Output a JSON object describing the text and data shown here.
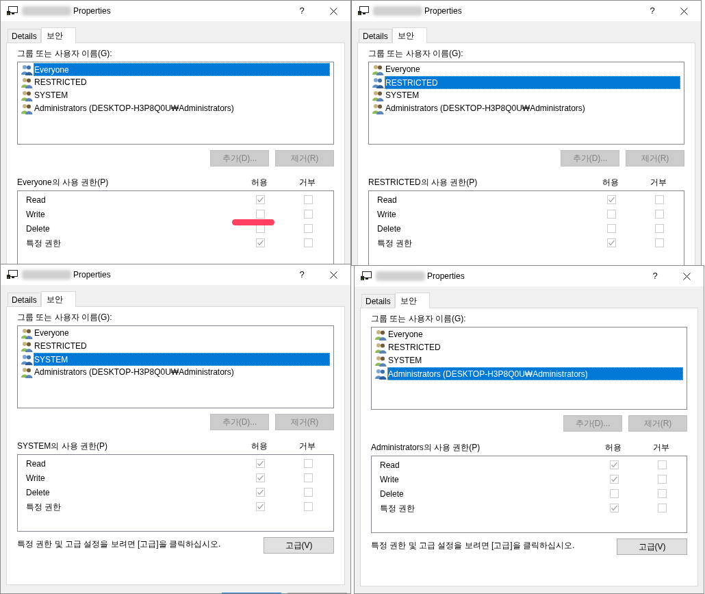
{
  "windows": [
    {
      "title": "Properties",
      "name_hidden": true,
      "help": "?",
      "tabs": [
        {
          "label": "Details",
          "selected": false
        },
        {
          "label": "보안",
          "selected": true
        }
      ],
      "groups_label": "그룹 또는 사용자 이름(G):",
      "groups": [
        {
          "name": "Everyone",
          "selected": true
        },
        {
          "name": "RESTRICTED",
          "selected": false
        },
        {
          "name": "SYSTEM",
          "selected": false
        },
        {
          "name": "Administrators (DESKTOP-H3P8Q0U₩Administrators)",
          "selected": false
        }
      ],
      "buttons": [
        {
          "label": "추가(D)...",
          "disabled": true
        },
        {
          "label": "제거(R)",
          "disabled": true
        }
      ],
      "permissions_label": "Everyone의 사용 권한(P)",
      "columns": [
        "허용",
        "거부"
      ],
      "permissions": [
        {
          "name": "Read",
          "allow": true,
          "deny": false
        },
        {
          "name": "Write",
          "allow": false,
          "deny": false
        },
        {
          "name": "Delete",
          "allow": false,
          "deny": false
        },
        {
          "name": "특정 권한",
          "allow": true,
          "deny": false
        }
      ],
      "highlight_stroke": true
    },
    {
      "title": "Properties",
      "name_hidden": true,
      "help": "?",
      "tabs": [
        {
          "label": "Details",
          "selected": false
        },
        {
          "label": "보안",
          "selected": true
        }
      ],
      "groups_label": "그룹 또는 사용자 이름(G):",
      "groups": [
        {
          "name": "Everyone",
          "selected": false
        },
        {
          "name": "RESTRICTED",
          "selected": true
        },
        {
          "name": "SYSTEM",
          "selected": false
        },
        {
          "name": "Administrators (DESKTOP-H3P8Q0U₩Administrators)",
          "selected": false
        }
      ],
      "buttons": [
        {
          "label": "추가(D)...",
          "disabled": true
        },
        {
          "label": "제거(R)",
          "disabled": true
        }
      ],
      "permissions_label": "RESTRICTED의 사용 권한(P)",
      "columns": [
        "허용",
        "거부"
      ],
      "permissions": [
        {
          "name": "Read",
          "allow": true,
          "deny": false
        },
        {
          "name": "Write",
          "allow": false,
          "deny": false
        },
        {
          "name": "Delete",
          "allow": false,
          "deny": false
        },
        {
          "name": "특정 권한",
          "allow": true,
          "deny": false
        }
      ]
    },
    {
      "title": "Properties",
      "name_hidden": true,
      "help": "?",
      "tabs": [
        {
          "label": "Details",
          "selected": false
        },
        {
          "label": "보안",
          "selected": true
        }
      ],
      "groups_label": "그룹 또는 사용자 이름(G):",
      "groups": [
        {
          "name": "Everyone",
          "selected": false
        },
        {
          "name": "RESTRICTED",
          "selected": false
        },
        {
          "name": "SYSTEM",
          "selected": true
        },
        {
          "name": "Administrators (DESKTOP-H3P8Q0U₩Administrators)",
          "selected": false
        }
      ],
      "buttons": [
        {
          "label": "추가(D)...",
          "disabled": true
        },
        {
          "label": "제거(R)",
          "disabled": true
        }
      ],
      "permissions_label": "SYSTEM의 사용 권한(P)",
      "columns": [
        "허용",
        "거부"
      ],
      "permissions": [
        {
          "name": "Read",
          "allow": true,
          "deny": false
        },
        {
          "name": "Write",
          "allow": true,
          "deny": false
        },
        {
          "name": "Delete",
          "allow": true,
          "deny": false
        },
        {
          "name": "특정 권한",
          "allow": true,
          "deny": false
        }
      ],
      "note": "특정 권한 및 고급 설정을 보려면 [고급]을 클릭하십시오.",
      "advanced_button": "고급(V)",
      "footer_buttons": [
        {
          "default": true
        },
        {
          "default": false
        }
      ]
    },
    {
      "title": "Properties",
      "name_hidden": true,
      "help": "?",
      "tabs": [
        {
          "label": "Details",
          "selected": false
        },
        {
          "label": "보안",
          "selected": true
        }
      ],
      "groups_label": "그룹 또는 사용자 이름(G):",
      "groups": [
        {
          "name": "Everyone",
          "selected": false
        },
        {
          "name": "RESTRICTED",
          "selected": false
        },
        {
          "name": "SYSTEM",
          "selected": false
        },
        {
          "name": "Administrators (DESKTOP-H3P8Q0U₩Administrators)",
          "selected": true
        }
      ],
      "buttons": [
        {
          "label": "추가(D)...",
          "disabled": true
        },
        {
          "label": "제거(R)",
          "disabled": true
        }
      ],
      "permissions_label": "Administrators의 사용 권한(P)",
      "columns": [
        "허용",
        "거부"
      ],
      "permissions": [
        {
          "name": "Read",
          "allow": true,
          "deny": false
        },
        {
          "name": "Write",
          "allow": true,
          "deny": false
        },
        {
          "name": "Delete",
          "allow": false,
          "deny": false
        },
        {
          "name": "특정 권한",
          "allow": true,
          "deny": false
        }
      ],
      "note": "특정 권한 및 고급 설정을 보려면 [고급]을 클릭하십시오.",
      "advanced_button": "고급(V)"
    }
  ]
}
